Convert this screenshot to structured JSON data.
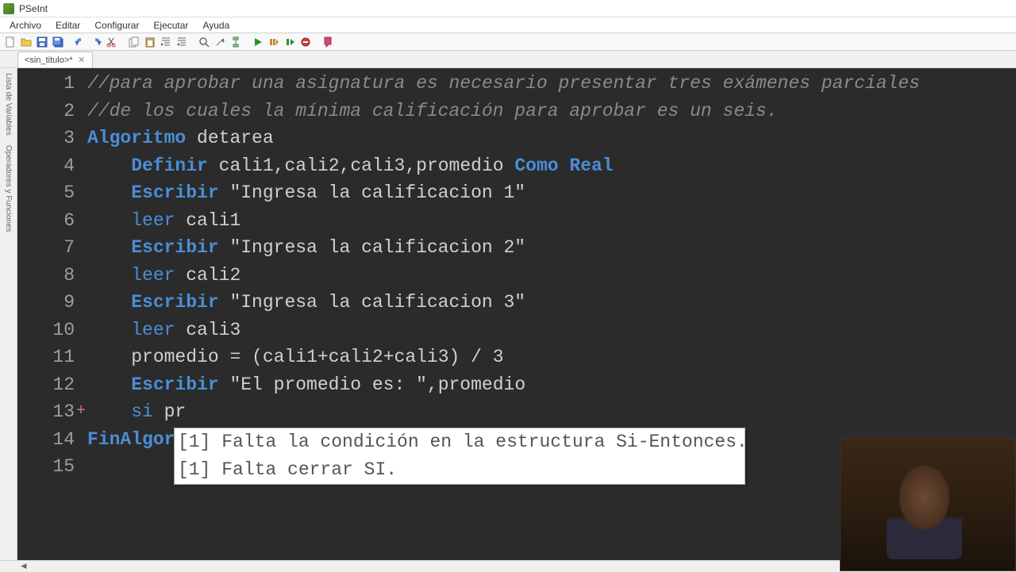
{
  "app": {
    "title": "PSeInt"
  },
  "menu": {
    "items": [
      "Archivo",
      "Editar",
      "Configurar",
      "Ejecutar",
      "Ayuda"
    ]
  },
  "tab": {
    "label": "<sin_titulo>*"
  },
  "sidebar": {
    "items": [
      "Lista de Variables",
      "Operadores y Funciones"
    ]
  },
  "code": {
    "lines": [
      {
        "n": 1,
        "tokens": [
          {
            "t": "//para aprobar una asignatura es necesario presentar tres exámenes parciales",
            "c": "comment"
          }
        ]
      },
      {
        "n": 2,
        "tokens": [
          {
            "t": "//de los cuales la mínima calificación para aprobar es un seis.",
            "c": "comment"
          }
        ]
      },
      {
        "n": 3,
        "tokens": [
          {
            "t": "Algoritmo",
            "c": "kw"
          },
          {
            "t": " detarea",
            "c": "id"
          }
        ]
      },
      {
        "n": 4,
        "tokens": [
          {
            "t": "    ",
            "c": "id"
          },
          {
            "t": "Definir",
            "c": "kw"
          },
          {
            "t": " cali1",
            "c": "id"
          },
          {
            "t": ",",
            "c": "op"
          },
          {
            "t": "cali2",
            "c": "id"
          },
          {
            "t": ",",
            "c": "op"
          },
          {
            "t": "cali3",
            "c": "id"
          },
          {
            "t": ",",
            "c": "op"
          },
          {
            "t": "promedio ",
            "c": "id"
          },
          {
            "t": "Como Real",
            "c": "type"
          }
        ]
      },
      {
        "n": 5,
        "tokens": [
          {
            "t": "    ",
            "c": "id"
          },
          {
            "t": "Escribir",
            "c": "kw"
          },
          {
            "t": " \"Ingresa la calificacion 1\"",
            "c": "str"
          }
        ]
      },
      {
        "n": 6,
        "tokens": [
          {
            "t": "    ",
            "c": "id"
          },
          {
            "t": "leer",
            "c": "kw2"
          },
          {
            "t": " cali1",
            "c": "id"
          }
        ]
      },
      {
        "n": 7,
        "tokens": [
          {
            "t": "    ",
            "c": "id"
          },
          {
            "t": "Escribir",
            "c": "kw"
          },
          {
            "t": " \"Ingresa la calificacion 2\"",
            "c": "str"
          }
        ]
      },
      {
        "n": 8,
        "tokens": [
          {
            "t": "    ",
            "c": "id"
          },
          {
            "t": "leer",
            "c": "kw2"
          },
          {
            "t": " cali2",
            "c": "id"
          }
        ]
      },
      {
        "n": 9,
        "tokens": [
          {
            "t": "    ",
            "c": "id"
          },
          {
            "t": "Escribir",
            "c": "kw"
          },
          {
            "t": " \"Ingresa la calificacion 3\"",
            "c": "str"
          }
        ]
      },
      {
        "n": 10,
        "tokens": [
          {
            "t": "    ",
            "c": "id"
          },
          {
            "t": "leer",
            "c": "kw2"
          },
          {
            "t": " cali3",
            "c": "id"
          }
        ]
      },
      {
        "n": 11,
        "tokens": [
          {
            "t": "    promedio ",
            "c": "id"
          },
          {
            "t": "=",
            "c": "op"
          },
          {
            "t": " (cali1",
            "c": "id"
          },
          {
            "t": "+",
            "c": "op"
          },
          {
            "t": "cali2",
            "c": "id"
          },
          {
            "t": "+",
            "c": "op"
          },
          {
            "t": "cali3) ",
            "c": "id"
          },
          {
            "t": "/",
            "c": "op"
          },
          {
            "t": " 3",
            "c": "num"
          }
        ]
      },
      {
        "n": 12,
        "tokens": [
          {
            "t": "    ",
            "c": "id"
          },
          {
            "t": "Escribir",
            "c": "kw"
          },
          {
            "t": " \"El promedio es: \"",
            "c": "str"
          },
          {
            "t": ",",
            "c": "op"
          },
          {
            "t": "promedio",
            "c": "id"
          }
        ]
      },
      {
        "n": 13,
        "err": true,
        "tokens": [
          {
            "t": "    ",
            "c": "id"
          },
          {
            "t": "si",
            "c": "kw2"
          },
          {
            "t": " pr",
            "c": "id"
          }
        ]
      },
      {
        "n": 14,
        "tokens": [
          {
            "t": "FinAlgor",
            "c": "kw"
          }
        ]
      },
      {
        "n": 15,
        "tokens": []
      }
    ]
  },
  "errors": {
    "messages": [
      "[1] Falta la condición en la estructura Si-Entonces.",
      "[1] Falta cerrar SI."
    ]
  },
  "toolbar": {
    "icons": [
      "new-file",
      "open-file",
      "save-file",
      "save-all",
      "comment",
      "undo",
      "redo",
      "cut",
      "copy",
      "paste",
      "indent",
      "outdent",
      "find",
      "tools",
      "flowchart",
      "run",
      "step",
      "debug",
      "stop",
      "help"
    ]
  }
}
